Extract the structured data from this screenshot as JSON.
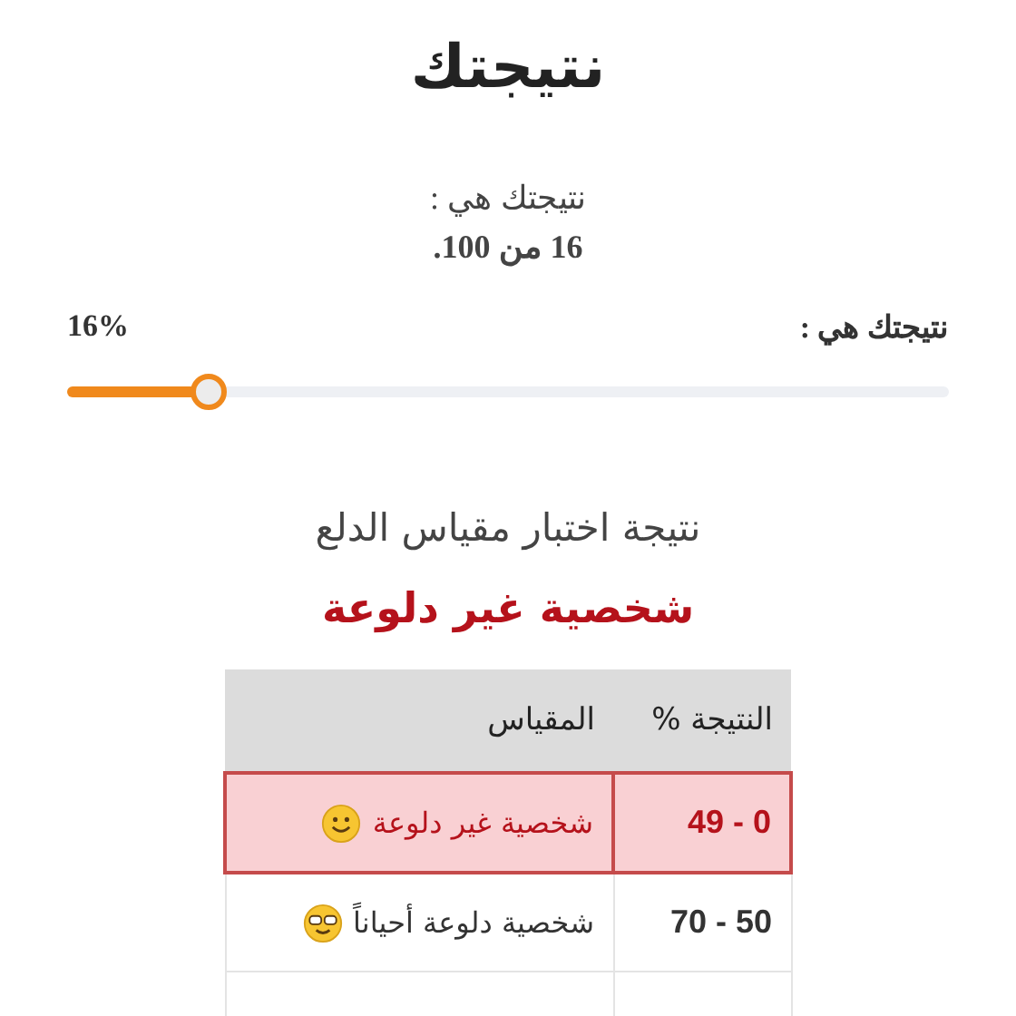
{
  "title": "نتيجتك",
  "summary": {
    "label": "نتيجتك هي :",
    "score": "16 من 100."
  },
  "meter": {
    "label": "نتيجتك هي :",
    "reading": "16%",
    "level": 0.16
  },
  "result": {
    "heading": "نتيجة اختبار مقياس الدلع",
    "verdict": "شخصية غير دلوعة"
  },
  "table": {
    "columns": [
      "النتيجة %",
      "المقياس"
    ],
    "rows": [
      {
        "range": "0 - 49",
        "description": "شخصية غير دلوعة",
        "selected": true
      },
      {
        "range": "50 - 70",
        "description": "شخصية دلوعة أحياناً",
        "selected": false
      }
    ]
  }
}
